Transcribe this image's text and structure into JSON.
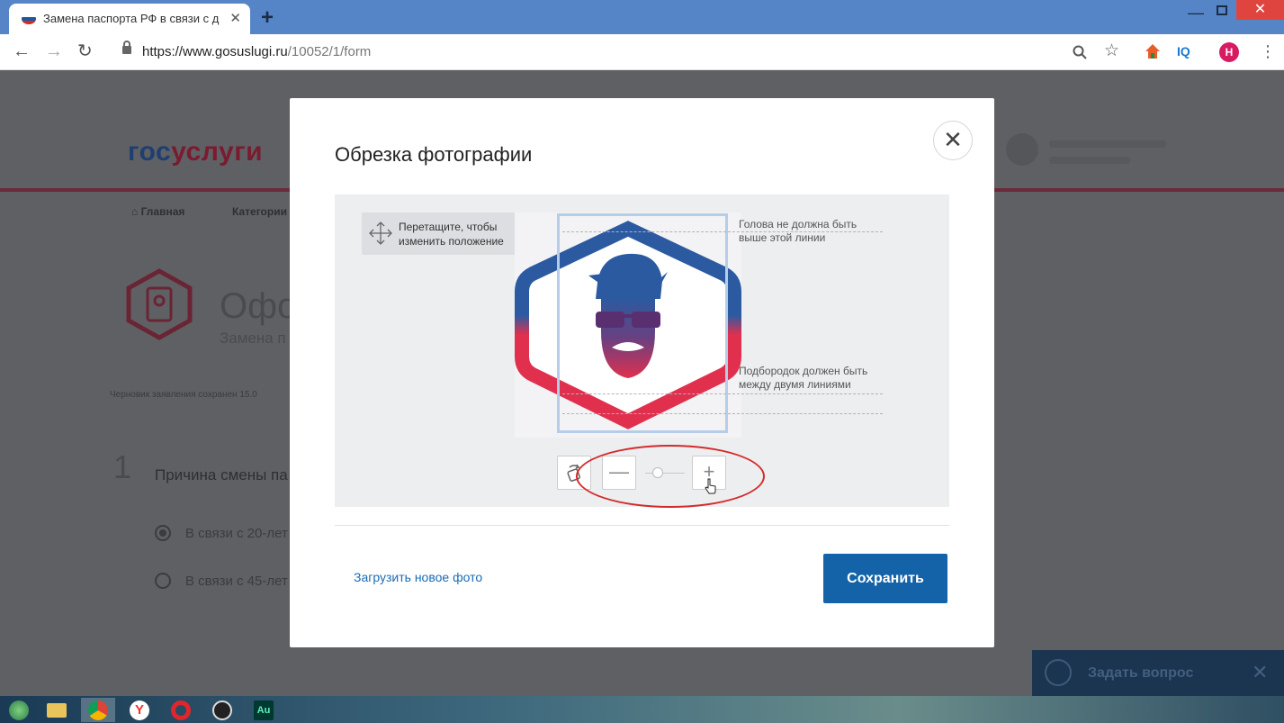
{
  "browser": {
    "tab_title": "Замена паспорта РФ в связи с д",
    "tab_close": "✕",
    "new_tab": "+",
    "url_host": "https://www.gosuslugi.ru",
    "url_path": "/10052/1/form",
    "avatar_letter": "Н",
    "iq_label": "IQ",
    "window_min": "—",
    "window_close": "✕"
  },
  "page": {
    "logo_part1": "гос",
    "logo_part2": "услуги",
    "nav_home": "Главная",
    "nav_categories": "Категории",
    "heading": "Оформ",
    "subheading": "Замена п",
    "draft_notice": "Черновик заявления сохранен 15.0",
    "step_number": "1",
    "step_title": "Причина смены па",
    "option_1": "В связи с 20-лет",
    "option_2": "В связи с 45-лет",
    "ask_label": "Задать вопрос",
    "ask_close": "✕"
  },
  "modal": {
    "title": "Обрезка фотографии",
    "close": "✕",
    "drag_hint_line1": "Перетащите, чтобы",
    "drag_hint_line2": "изменить положение",
    "guide_top_line1": "Голова не должна быть",
    "guide_top_line2": "выше этой линии",
    "guide_bottom_line1": "Подбородок должен быть",
    "guide_bottom_line2": "между двумя линиями",
    "zoom_out": "—",
    "zoom_in": "+",
    "upload_link": "Загрузить новое фото",
    "save_button": "Сохранить"
  },
  "colors": {
    "brand_blue": "#1463a8",
    "link_blue": "#1b6bb4",
    "hex_blue": "#2c5aa0",
    "hex_red": "#e0304e",
    "highlight_red": "#d42a2a",
    "tabbar": "#5585c7"
  },
  "icons": [
    "back-arrow-icon",
    "forward-arrow-icon",
    "reload-icon",
    "lock-icon",
    "zoom-icon",
    "star-icon",
    "home-icon",
    "menu-dots-icon",
    "move-arrows-icon",
    "rotate-icon",
    "close-icon",
    "hand-cursor-icon",
    "question-face-icon"
  ]
}
